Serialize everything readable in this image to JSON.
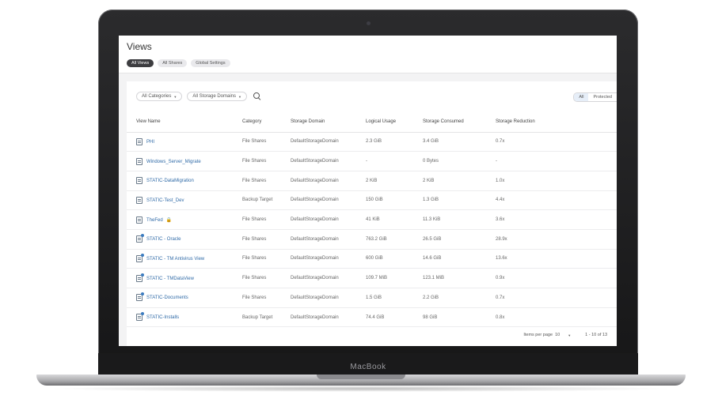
{
  "device": {
    "brand": "MacBook"
  },
  "page": {
    "title": "Views",
    "tabs": [
      {
        "label": "All Views",
        "active": true
      },
      {
        "label": "All Shares",
        "active": false
      },
      {
        "label": "Global Settings",
        "active": false
      }
    ]
  },
  "filters": {
    "category": "All Categories",
    "storage_domain": "All Storage Domains",
    "toggle": [
      {
        "label": "All",
        "active": true
      },
      {
        "label": "Protected",
        "active": false
      }
    ]
  },
  "table": {
    "columns": [
      "View Name",
      "Category",
      "Storage Domain",
      "Logical Usage",
      "Storage Consumed",
      "Storage Reduction"
    ],
    "rows": [
      {
        "name": "PHI",
        "category": "File Shares",
        "domain": "DefaultStorageDomain",
        "logical": "2.3 GiB",
        "consumed": "3.4 GiB",
        "reduction": "0.7x",
        "icon": "view-icon"
      },
      {
        "name": "Windows_Server_Migrate",
        "category": "File Shares",
        "domain": "DefaultStorageDomain",
        "logical": "-",
        "consumed": "0 Bytes",
        "reduction": "-",
        "icon": "view-icon"
      },
      {
        "name": "STATIC-DataMigration",
        "category": "File Shares",
        "domain": "DefaultStorageDomain",
        "logical": "2 KiB",
        "consumed": "2 KiB",
        "reduction": "1.0x",
        "icon": "view-icon"
      },
      {
        "name": "STATIC-Test_Dev",
        "category": "Backup Target",
        "domain": "DefaultStorageDomain",
        "logical": "150 GiB",
        "consumed": "1.3 GiB",
        "reduction": "4.4x",
        "icon": "view-icon"
      },
      {
        "name": "TheFed",
        "category": "File Shares",
        "domain": "DefaultStorageDomain",
        "logical": "41 KiB",
        "consumed": "11.3 KiB",
        "reduction": "3.6x",
        "icon": "view-icon",
        "locked": true
      },
      {
        "name": "STATIC - Oracle",
        "category": "File Shares",
        "domain": "DefaultStorageDomain",
        "logical": "763.2 GiB",
        "consumed": "26.5 GiB",
        "reduction": "28.9x",
        "icon": "protected-view-icon"
      },
      {
        "name": "STATIC - TM Antivirus View",
        "category": "File Shares",
        "domain": "DefaultStorageDomain",
        "logical": "600 GiB",
        "consumed": "14.6 GiB",
        "reduction": "13.6x",
        "icon": "protected-view-icon"
      },
      {
        "name": "STATIC - TMDataView",
        "category": "File Shares",
        "domain": "DefaultStorageDomain",
        "logical": "109.7 MiB",
        "consumed": "123.1 MiB",
        "reduction": "0.9x",
        "icon": "protected-view-icon"
      },
      {
        "name": "STATIC-Documents",
        "category": "File Shares",
        "domain": "DefaultStorageDomain",
        "logical": "1.5 GiB",
        "consumed": "2.2 GiB",
        "reduction": "0.7x",
        "icon": "protected-view-icon"
      },
      {
        "name": "STATIC-Installs",
        "category": "Backup Target",
        "domain": "DefaultStorageDomain",
        "logical": "74.4 GiB",
        "consumed": "98 GiB",
        "reduction": "0.8x",
        "icon": "protected-view-icon"
      }
    ]
  },
  "pager": {
    "items_label": "Items per page",
    "per_page": "10",
    "range": "1 - 10 of 13"
  }
}
